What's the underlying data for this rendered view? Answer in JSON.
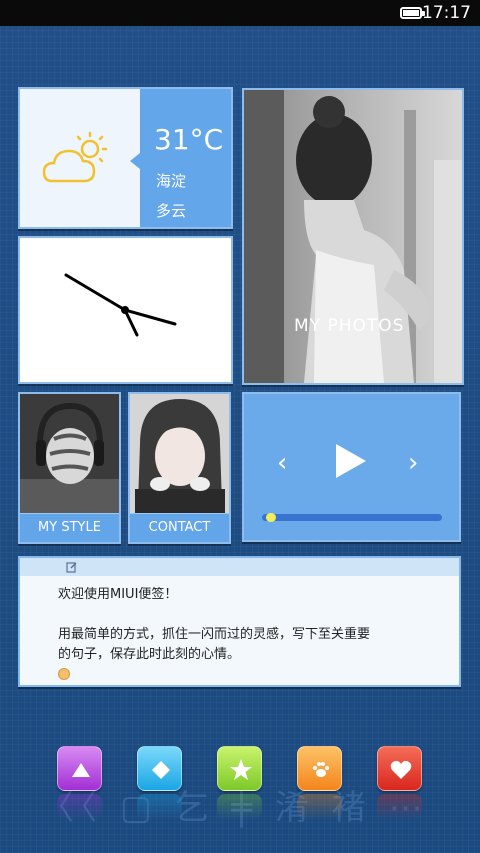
{
  "status_bar": {
    "time": "17:17",
    "battery_icon": "battery-full-icon"
  },
  "weather": {
    "temperature": "31°C",
    "location": "海淀",
    "condition": "多云",
    "icon": "partly-cloudy-icon"
  },
  "clock_widget": {
    "hour_hand_angle_deg": 300,
    "minute_hand_angle_deg": 97
  },
  "photos": {
    "label": "MY  PHOTOS"
  },
  "tiles": {
    "my_style": "MY STYLE",
    "contact": "CONTACT"
  },
  "music": {
    "prev_icon": "‹",
    "next_icon": "›",
    "progress": 0.02
  },
  "note": {
    "line1": "欢迎使用MIUI便签！",
    "line2": "用最简单的方式，抓住一闪而过的灵感，写下至关重要",
    "line3": "的句子，保存此时此刻的心情。",
    "edit_icon": "edit-icon",
    "emoji_icon": "smile-icon"
  },
  "dock": [
    {
      "name": "triangle-app",
      "color": "#b845e2",
      "icon": "triangle-icon"
    },
    {
      "name": "diamond-app",
      "color": "#29b6ee",
      "icon": "diamond-icon"
    },
    {
      "name": "star-app",
      "color": "#8fd93a",
      "icon": "star-icon"
    },
    {
      "name": "paw-app",
      "color": "#f79a25",
      "icon": "paw-icon"
    },
    {
      "name": "heart-app",
      "color": "#e8352a",
      "icon": "heart-icon"
    }
  ],
  "colors": {
    "tile_blue": "#63a6ea",
    "background": "#1f4f86"
  }
}
